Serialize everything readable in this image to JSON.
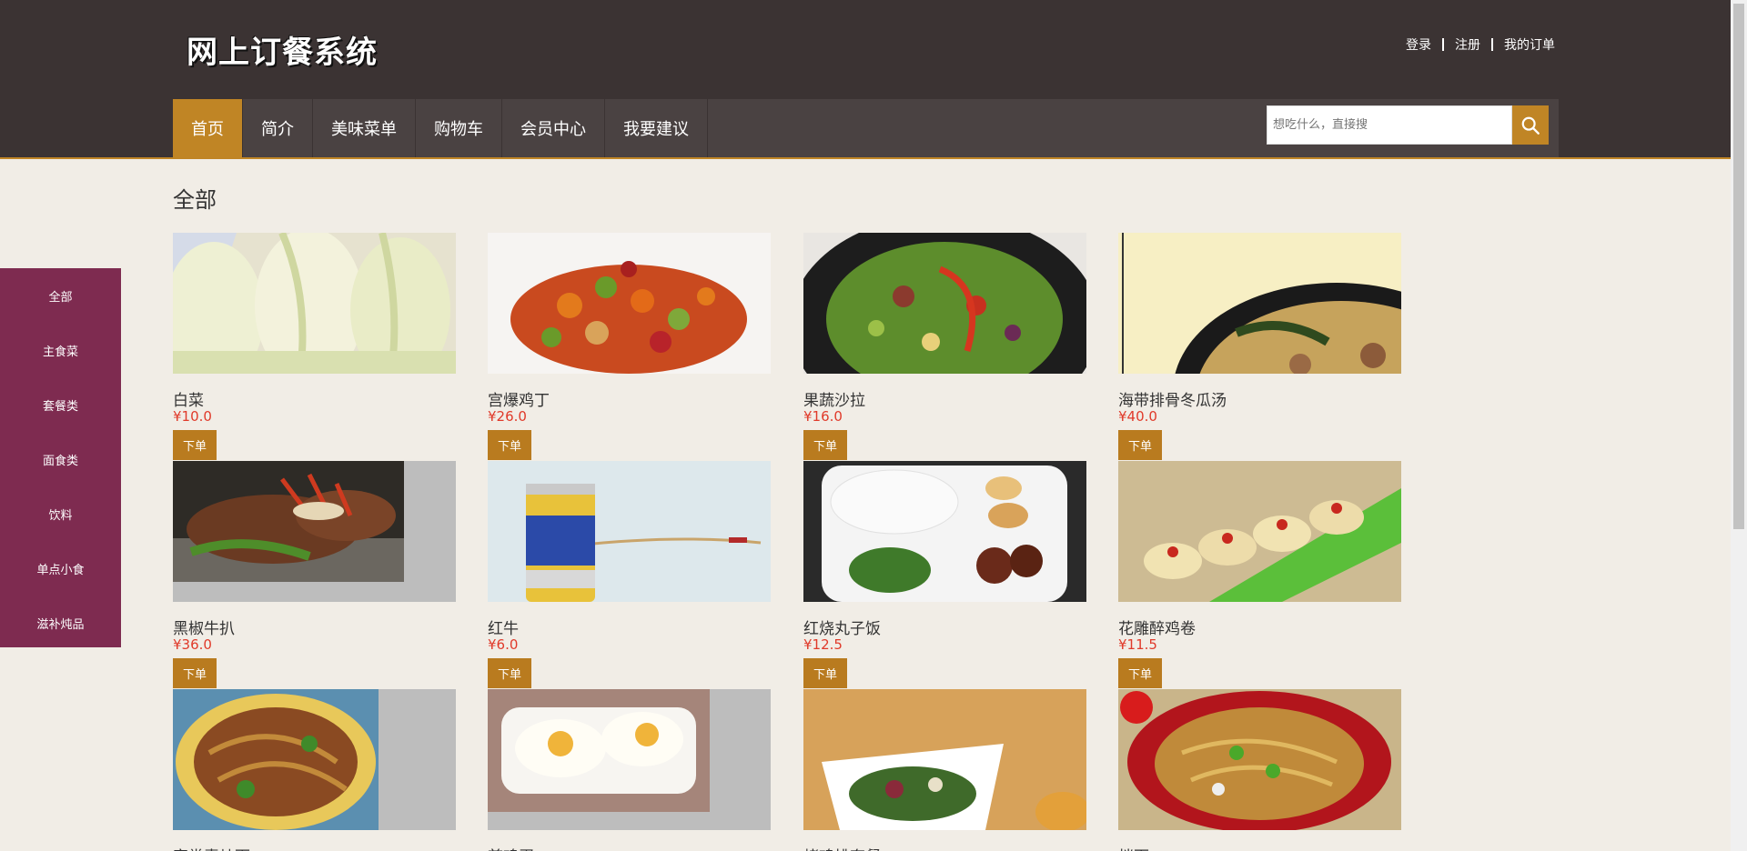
{
  "header": {
    "logo": "网上订餐系统",
    "links": [
      "登录",
      "注册",
      "我的订单"
    ]
  },
  "nav": {
    "items": [
      "首页",
      "简介",
      "美味菜单",
      "购物车",
      "会员中心",
      "我要建议"
    ],
    "active_index": 0
  },
  "search": {
    "placeholder": "想吃什么，直接搜"
  },
  "sidebar": {
    "items": [
      "全部",
      "主食菜",
      "套餐类",
      "面食类",
      "饮料",
      "单点小食",
      "滋补炖品"
    ]
  },
  "main": {
    "title": "全部",
    "order_label": "下单",
    "dishes": [
      {
        "name": "白菜",
        "price": "¥10.0"
      },
      {
        "name": "宫爆鸡丁",
        "price": "¥26.0"
      },
      {
        "name": "果蔬沙拉",
        "price": "¥16.0"
      },
      {
        "name": "海带排骨冬瓜汤",
        "price": "¥40.0"
      },
      {
        "name": "黑椒牛扒",
        "price": "¥36.0"
      },
      {
        "name": "红牛",
        "price": "¥6.0"
      },
      {
        "name": "红烧丸子饭",
        "price": "¥12.5"
      },
      {
        "name": "花雕醉鸡卷",
        "price": "¥11.5"
      },
      {
        "name": "家常素炒面",
        "price": ""
      },
      {
        "name": "煎鸡蛋",
        "price": ""
      },
      {
        "name": "烤鸡排套餐",
        "price": ""
      },
      {
        "name": "拌面",
        "price": ""
      }
    ]
  },
  "colors": {
    "header_bg": "#3b3333",
    "accent": "#c08525",
    "sidebar_bg": "#7e2b50",
    "price": "#e03a2a",
    "page_bg": "#f1ede6"
  }
}
